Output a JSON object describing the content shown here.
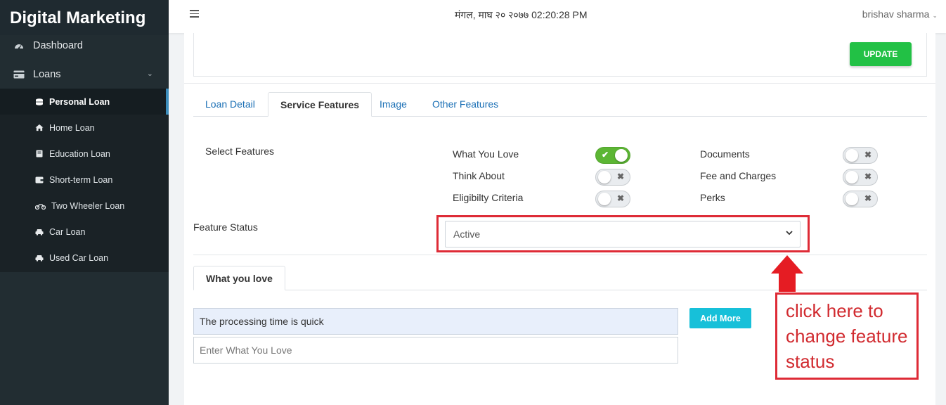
{
  "app": {
    "title": "Digital Marketing"
  },
  "sidebar": {
    "items": [
      {
        "label": "Dashboard",
        "icon": "dashboard-icon"
      },
      {
        "label": "Loans",
        "icon": "loans-icon"
      }
    ],
    "submenu": [
      {
        "label": "Personal Loan",
        "icon": "coins-icon",
        "active": true
      },
      {
        "label": "Home Loan",
        "icon": "home-icon"
      },
      {
        "label": "Education Loan",
        "icon": "book-icon"
      },
      {
        "label": "Short-term Loan",
        "icon": "wallet-icon"
      },
      {
        "label": "Two Wheeler Loan",
        "icon": "motorcycle-icon"
      },
      {
        "label": "Car Loan",
        "icon": "car-icon"
      },
      {
        "label": "Used Car Loan",
        "icon": "car-icon"
      }
    ]
  },
  "topbar": {
    "datetime": "मंगल, माघ २० २०७७ 02:20:28 PM",
    "user": "brishav sharma"
  },
  "top_box": {
    "update_label": "UPDATE"
  },
  "tabs": [
    "Loan Detail",
    "Service Features",
    "Image",
    "Other Features"
  ],
  "active_tab": "Service Features",
  "features": {
    "label": "Select Features",
    "items": [
      {
        "label": "What You Love",
        "enabled": true
      },
      {
        "label": "Think About",
        "enabled": false
      },
      {
        "label": "Eligibilty Criteria",
        "enabled": false
      },
      {
        "label": "Documents",
        "enabled": false
      },
      {
        "label": "Fee and Charges",
        "enabled": false
      },
      {
        "label": "Perks",
        "enabled": false
      }
    ]
  },
  "feature_status": {
    "label": "Feature Status",
    "value": "Active"
  },
  "subtab": {
    "label": "What you love"
  },
  "what_you_love": {
    "entries": [
      "The processing time is quick"
    ],
    "placeholder": "Enter What You Love",
    "add_more_label": "Add More"
  },
  "annotation": {
    "text": "click here to change feature status"
  },
  "colors": {
    "sidebar_bg": "#222d32",
    "update_button": "#22c145",
    "add_more_button": "#17c0d9",
    "toggle_on": "#5cb634",
    "annotation_red": "#de2b36",
    "tab_link": "#1a6fb5"
  }
}
